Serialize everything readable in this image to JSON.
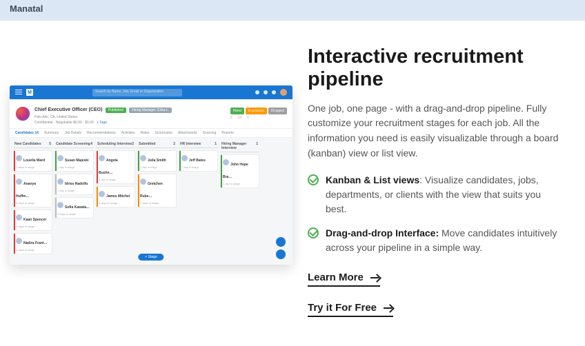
{
  "banner": {
    "brand": "Manatal"
  },
  "copy": {
    "heading": "Interactive recruitment pipeline",
    "paragraph": "One job, one page - with a drag-and-drop pipeline. Fully customize your recruitment stages for each job. All the information you need is easily visualizable through a board (kanban) view or list view.",
    "features": [
      {
        "title": "Kanban & List views",
        "body": ": Visualize candidates, jobs, departments, or clients with the view that suits you best."
      },
      {
        "title": "Drag-and-drop Interface:",
        "body": " Move candidates intuitively across your pipeline in a simple way."
      }
    ],
    "cta1": "Learn More",
    "cta2": "Try it For Free"
  },
  "app": {
    "logo": "M",
    "search_placeholder": "Search by Name, Job, Email or Organization",
    "job": {
      "title": "Chief Executive Officer (CEO)",
      "status_pill": "Published",
      "manager_label": "Hiring Manager: Erika L.",
      "location": "Palo Alto, CA, United States",
      "conf": "Confidential",
      "salary": "Negotiable $0.00 - $0.00",
      "tags": "+ Tags",
      "stats": {
        "hired": "Hired",
        "in_process": "In process",
        "dropped": "Dropped"
      },
      "nums": [
        "0",
        "13",
        "1"
      ]
    },
    "tabs": [
      "Candidates",
      "Summary",
      "Job Details",
      "Recommendations",
      "Activities",
      "Notes",
      "Scorecards",
      "Attachments",
      "Sourcing",
      "Reports"
    ],
    "tab_count": "14",
    "columns": [
      {
        "name": "New Candidates",
        "count": "5"
      },
      {
        "name": "Candidate Screening",
        "count": "4"
      },
      {
        "name": "Scheduling Interview",
        "count": "2"
      },
      {
        "name": "Submitted",
        "count": "2"
      },
      {
        "name": "HR Interview",
        "count": "1"
      },
      {
        "name": "Hiring Manager Interview",
        "count": "1"
      }
    ],
    "cards": {
      "c0": [
        {
          "n": "Louella Ward",
          "bar": "red"
        },
        {
          "n": "Ananya Huffm…",
          "bar": "red"
        },
        {
          "n": "Kaan Spencer",
          "bar": "red"
        },
        {
          "n": "Nadira Frant…",
          "bar": "red"
        }
      ],
      "c1": [
        {
          "n": "Susan Majeski",
          "bar": "green"
        },
        {
          "n": "Idriss Nadolfu",
          "bar": "grey"
        },
        {
          "n": "Sofia Kawata…",
          "bar": "grey"
        }
      ],
      "c2": [
        {
          "n": "Angela Bushn…",
          "bar": "red"
        },
        {
          "n": "James Mitchel",
          "bar": "orange"
        }
      ],
      "c3": [
        {
          "n": "Julia Smith",
          "bar": "green"
        },
        {
          "n": "Gretchen Rube…",
          "bar": "orange"
        }
      ],
      "c4": [
        {
          "n": "Jeff Bates",
          "bar": "green"
        }
      ],
      "c5": [
        {
          "n": "John Hope Bra…",
          "bar": "green"
        }
      ]
    },
    "stage_chip": "+ Stage"
  }
}
